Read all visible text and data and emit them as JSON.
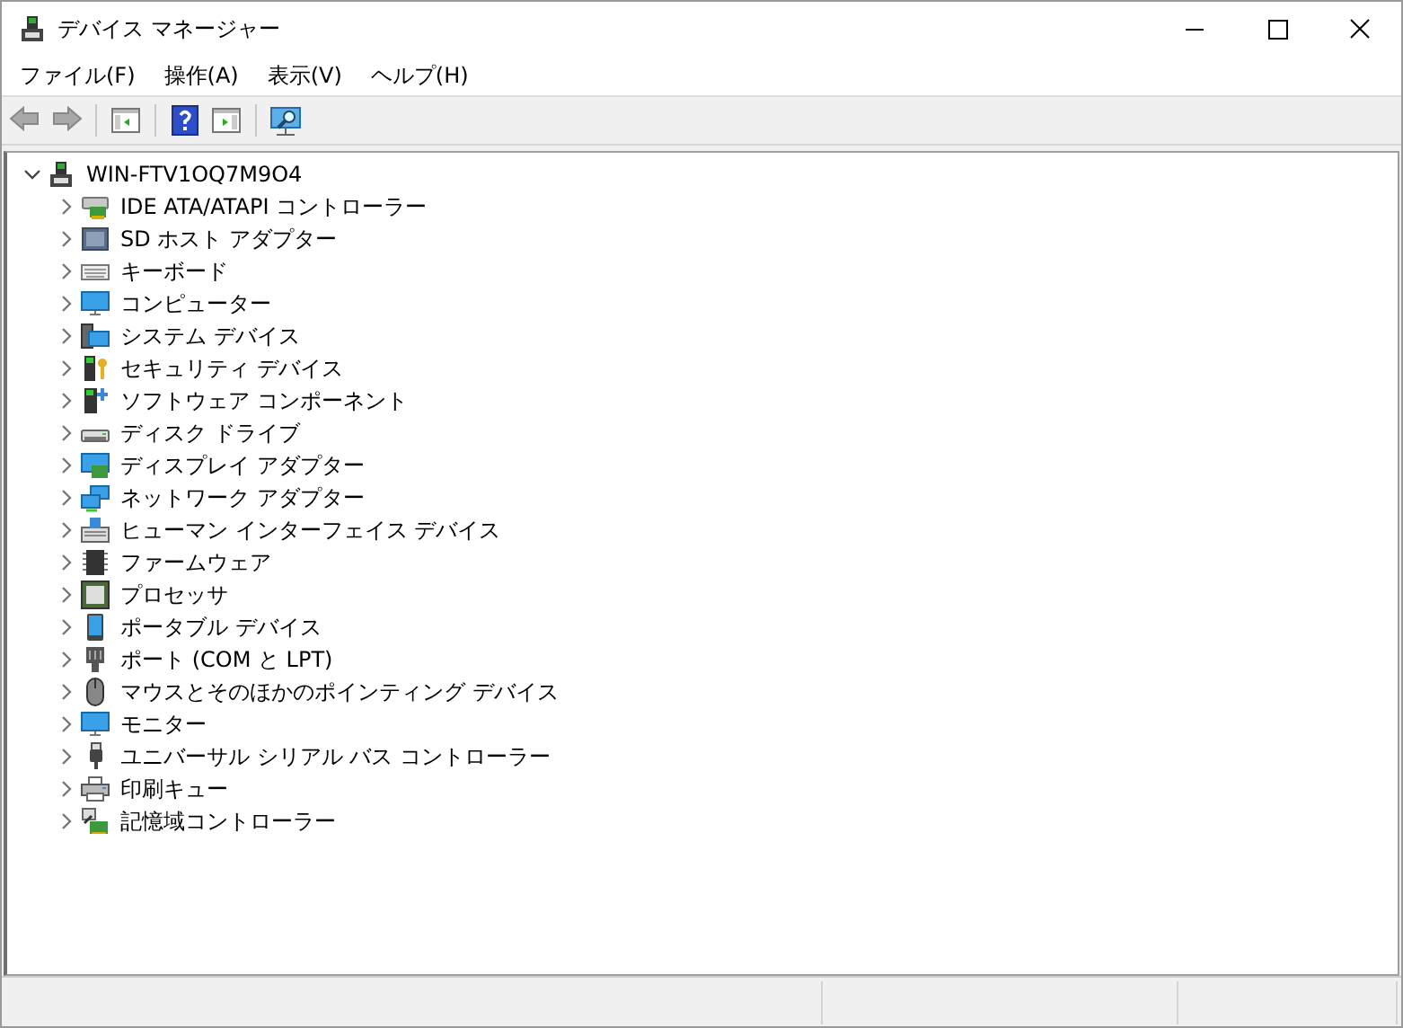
{
  "window": {
    "title": "デバイス マネージャー"
  },
  "menu": [
    "ファイル(F)",
    "操作(A)",
    "表示(V)",
    "ヘルプ(H)"
  ],
  "toolbar": [
    {
      "kind": "back",
      "disabled": true
    },
    {
      "kind": "forward",
      "disabled": true
    },
    {
      "kind": "sep"
    },
    {
      "kind": "console"
    },
    {
      "kind": "sep"
    },
    {
      "kind": "help"
    },
    {
      "kind": "panel"
    },
    {
      "kind": "sep"
    },
    {
      "kind": "scan"
    }
  ],
  "tree": {
    "label": "WIN-FTV1OQ7M9O4",
    "expanded": true,
    "children": [
      {
        "label": "IDE ATA/ATAPI コントローラー",
        "expanded": false,
        "kind": "controller"
      },
      {
        "label": "SD ホスト アダプター",
        "expanded": false,
        "kind": "sd"
      },
      {
        "label": "キーボード",
        "expanded": false,
        "kind": "keyboard"
      },
      {
        "label": "コンピューター",
        "expanded": false,
        "kind": "monitor"
      },
      {
        "label": "システム デバイス",
        "expanded": false,
        "kind": "system"
      },
      {
        "label": "セキュリティ デバイス",
        "expanded": false,
        "kind": "security"
      },
      {
        "label": "ソフトウェア コンポーネント",
        "expanded": false,
        "kind": "software"
      },
      {
        "label": "ディスク ドライブ",
        "expanded": false,
        "kind": "disk"
      },
      {
        "label": "ディスプレイ アダプター",
        "expanded": false,
        "kind": "display"
      },
      {
        "label": "ネットワーク アダプター",
        "expanded": false,
        "kind": "network"
      },
      {
        "label": "ヒューマン インターフェイス デバイス",
        "expanded": false,
        "kind": "hid"
      },
      {
        "label": "ファームウェア",
        "expanded": false,
        "kind": "firmware"
      },
      {
        "label": "プロセッサ",
        "expanded": false,
        "kind": "processor"
      },
      {
        "label": "ポータブル デバイス",
        "expanded": false,
        "kind": "portable"
      },
      {
        "label": "ポート (COM と LPT)",
        "expanded": false,
        "kind": "port"
      },
      {
        "label": "マウスとそのほかのポインティング デバイス",
        "expanded": false,
        "kind": "mouse"
      },
      {
        "label": "モニター",
        "expanded": false,
        "kind": "monitor"
      },
      {
        "label": "ユニバーサル シリアル バス コントローラー",
        "expanded": false,
        "kind": "usb"
      },
      {
        "label": "印刷キュー",
        "expanded": false,
        "kind": "printer"
      },
      {
        "label": "記憶域コントローラー",
        "expanded": false,
        "kind": "storage"
      }
    ]
  }
}
